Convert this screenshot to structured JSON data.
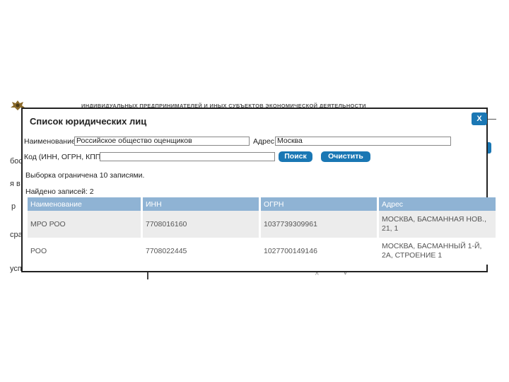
{
  "background": {
    "header_text": "ИНДИВИДУАЛЬНЫХ ПРЕДПРИНИМАТЕЛЕЙ И ИНЫХ СУБЪЕКТОВ ЭКОНОМИЧЕСКОЙ ДЕЯТЕЛЬНОСТИ",
    "frag_1": "бос",
    "frag_2": "я в",
    "frag_3": "р",
    "frag_4": "сра",
    "frag_5": "усп"
  },
  "modal": {
    "title": "Список юридических лиц",
    "close_label": "X",
    "form": {
      "name_label": "Наименование",
      "name_value": "Российское общество оценщиков",
      "address_label": "Адрес",
      "address_value": "Москва",
      "code_label": "Код (ИНН, ОГРН, КПП)",
      "code_value": "",
      "search_label": "Поиск",
      "clear_label": "Очистить"
    },
    "limit_text": "Выборка ограничена 10 записями.",
    "found_text": "Найдено записей: 2",
    "table": {
      "headers": [
        "Наименование",
        "ИНН",
        "ОГРН",
        "Адрес"
      ],
      "rows": [
        [
          "МРО РОО",
          "7708016160",
          "1037739309961",
          "МОСКВА, БАСМАННАЯ НОВ., 21, 1"
        ],
        [
          "РОО",
          "7708022445",
          "1027700149146",
          "МОСКВА, БАСМАННЫЙ 1-Й, 2А, СТРОЕНИЕ 1"
        ]
      ]
    }
  }
}
